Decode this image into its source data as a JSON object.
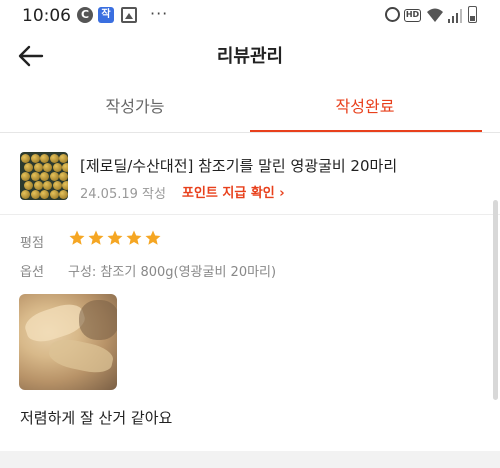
{
  "status_bar": {
    "time": "10:06",
    "c_badge": "C",
    "app_badge": "작",
    "more": "···",
    "hd": "HD"
  },
  "header": {
    "title": "리뷰관리",
    "back_icon": "arrow-left-icon"
  },
  "tabs": [
    {
      "label": "작성가능",
      "active": false
    },
    {
      "label": "작성완료",
      "active": true
    }
  ],
  "product": {
    "name": "[제로딜/수산대전] 참조기를 말린 영광굴비 20마리",
    "date": "24.05.19 작성",
    "point_link": "포인트 지급 확인 ›"
  },
  "review": {
    "rating_label": "평점",
    "rating": 5,
    "rating_max": 5,
    "option_label": "옵션",
    "option_value": "구성: 참조기 800g(영광굴비 20마리)",
    "text": "저렴하게 잘 산거 같아요"
  },
  "colors": {
    "accent": "#e8401c",
    "star": "#f5a623",
    "muted": "#888888"
  }
}
